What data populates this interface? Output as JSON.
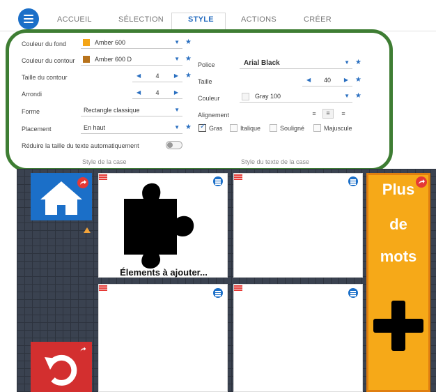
{
  "tabs": [
    {
      "label": "ACCUEIL"
    },
    {
      "label": "SÉLECTION"
    },
    {
      "label": "STYLE"
    },
    {
      "label": "ACTIONS"
    },
    {
      "label": "CRÉER"
    }
  ],
  "box_style": {
    "background_label": "Couleur du fond",
    "background_value": "Amber 600",
    "background_color": "#f4a516",
    "border_label": "Couleur du contour",
    "border_value": "Amber 600 D",
    "border_color": "#b8731c",
    "border_size_label": "Taille du contour",
    "border_size_value": "4",
    "radius_label": "Arrondi",
    "radius_value": "4",
    "shape_label": "Forme",
    "shape_value": "Rectangle classique",
    "placement_label": "Placement",
    "placement_value": "En haut",
    "auto_shrink_label": "Réduire la taille du texte automatiquement",
    "section_title": "Style de la case"
  },
  "text_style": {
    "font_label": "Police",
    "font_value": "Arial Black",
    "size_label": "Taille",
    "size_value": "40",
    "color_label": "Couleur",
    "color_value": "Gray 100",
    "color_swatch": "#f5f5f5",
    "align_label": "Alignement",
    "bold_label": "Gras",
    "italic_label": "Italique",
    "underline_label": "Souligné",
    "uppercase_label": "Majuscule",
    "section_title": "Style du texte de la case"
  },
  "grid": {
    "puzzle_label": "Élements à ajouter...",
    "more_words": [
      "Plus",
      "de",
      "mots"
    ],
    "accent_blue": "#1b6fc8",
    "accent_red": "#d32f2f",
    "accent_orange": "#f6a918"
  }
}
